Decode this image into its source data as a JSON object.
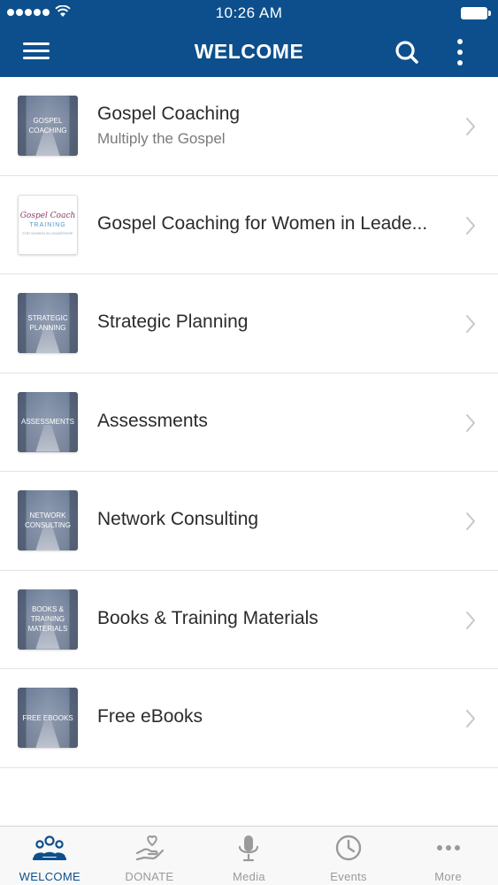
{
  "status_bar": {
    "time": "10:26 AM"
  },
  "app_bar": {
    "title": "WELCOME"
  },
  "items": [
    {
      "title": "Gospel Coaching",
      "subtitle": "Multiply the Gospel",
      "thumb_text": "GOSPEL COACHING"
    },
    {
      "title": "Gospel Coaching for Women in Leade...",
      "thumb_script": "Gospel Coach",
      "thumb_training": "TRAINING",
      "thumb_tagline": "FOR WOMEN IN LEADERSHIP"
    },
    {
      "title": "Strategic Planning",
      "thumb_text": "STRATEGIC PLANNING"
    },
    {
      "title": "Assessments",
      "thumb_text": "ASSESSMENTS"
    },
    {
      "title": "Network Consulting",
      "thumb_text": "NETWORK CONSULTING"
    },
    {
      "title": "Books & Training Materials",
      "thumb_text": "BOOKS & TRAINING MATERIALS"
    },
    {
      "title": "Free eBooks",
      "thumb_text": "FREE EBOOKS"
    }
  ],
  "tabs": [
    {
      "label": "WELCOME",
      "icon": "people-icon"
    },
    {
      "label": "DONATE",
      "icon": "donate-icon"
    },
    {
      "label": "Media",
      "icon": "microphone-icon"
    },
    {
      "label": "Events",
      "icon": "clock-icon"
    },
    {
      "label": "More",
      "icon": "more-icon"
    }
  ],
  "colors": {
    "brand": "#0d4f8c",
    "tab_inactive": "#9a9a9a"
  }
}
